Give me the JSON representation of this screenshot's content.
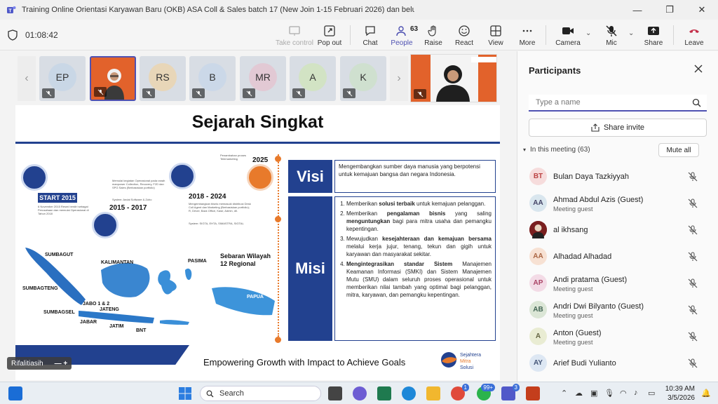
{
  "window": {
    "title": "Training Online Orientasi Karyawan Baru (OKB) ASA Coll & Sales batch 17 (New Join 1-15 Februari 2026) dan belu...",
    "minimize": "—",
    "restore": "❐",
    "close": "✕"
  },
  "toolbar": {
    "timer": "01:08:42",
    "take_control": "Take control",
    "pop_out": "Pop out",
    "chat": "Chat",
    "people": "People",
    "people_count": "63",
    "raise": "Raise",
    "react": "React",
    "view": "View",
    "more": "More",
    "camera": "Camera",
    "mic": "Mic",
    "share": "Share",
    "leave": "Leave"
  },
  "tiles": [
    {
      "initials": "EP",
      "color": "#c9d7e6"
    },
    {
      "initials": "",
      "video": true
    },
    {
      "initials": "RS",
      "color": "#e8d6b8"
    },
    {
      "initials": "B",
      "color": "#cbd8e8"
    },
    {
      "initials": "MR",
      "color": "#e2c9d4"
    },
    {
      "initials": "A",
      "color": "#d2e3c4"
    },
    {
      "initials": "K",
      "color": "#cfe0cf"
    }
  ],
  "slide": {
    "title": "Sejarah Singkat",
    "timeline": {
      "start": "START 2015",
      "y2015": "2015 - 2017",
      "y2018": "2018 - 2024",
      "y2025": "2025"
    },
    "tiny_text": {
      "t1": "6 November 2015 Resmi berdiri sebagai Perusahaan dan memulai Operasional di Tahun 2018",
      "t2": "Memulai kegiatan Operasional pada ranah manpower Collection, Recovery, F2D dan SPG Sales (Berbasiskan portfolio)",
      "t3": "System: Andal Software & Zoho",
      "t4": "Mengembangkan bisnis memasuki distribusi Desk Coll Agent dan Marketing (Berbasiskan portfolio); R, Driver, Back Office, Kasir, Admin, dll.",
      "t5": "System: SIGTA, EHTA, SIMASTRA, SIGTAL",
      "t6": "Penambahan proses Telemarketing"
    },
    "sebaran_line1": "Sebaran Wilayah",
    "sebaran_line2": "12 Regional",
    "regions": {
      "sumbagut": "SUMBAGUT",
      "kalimantan": "KALIMANTAN",
      "sumbagteng": "SUMBAGTENG",
      "jabo": "JABO 1 & 2",
      "jateng": "JATENG",
      "sumbagsel": "SUMBAGSEL",
      "jabar": "JABAR",
      "jatim": "JATIM",
      "bnt": "BNT",
      "pasima": "PASIMA",
      "papua": "PAPUA"
    },
    "visi_label": "Visi",
    "misi_label": "Misi",
    "visi_text": "Mengembangkan sumber daya manusia yang berpotensi untuk kemajuan bangsa dan negara Indonesia.",
    "misi": [
      {
        "pre": "Memberikan ",
        "bold": "solusi terbaik",
        "post": " untuk kemajuan pelanggan."
      },
      {
        "pre": "Memberikan ",
        "bold": "pengalaman bisnis",
        "post": " yang saling ",
        "bold2": "menguntungkan",
        "post2": " bagi para mitra usaha dan pemangku kepentingan."
      },
      {
        "pre": "Mewujudkan ",
        "bold": "kesejahteraan dan kemajuan bersama",
        "post": " melalui kerja jujur, tenang, tekun dan gigih untuk karyawan dan masyarakat sekitar."
      },
      {
        "pre": "",
        "bold": "Mengintegrasikan standar Sistem",
        "post": " Manajemen Keamanan Informasi (SMKI) dan Sistem Manajemen Mutu (SMU) dalam seluruh proses operasional untuk memberikan nilai tambah yang optimal bagi pelanggan, mitra, karyawan, dan pemangku kepentingan."
      }
    ],
    "footer": "Empowering Growth with Impact to Achieve Goals",
    "logo_line1": "Sejahtera",
    "logo_line2": "Mitra",
    "logo_line3": "Solusi"
  },
  "name_tag": {
    "name": "Rifalitiasih",
    "pin": "—   +"
  },
  "panel": {
    "title": "Participants",
    "search_placeholder": "Type a name",
    "share_invite": "Share invite",
    "in_meeting": "In this meeting (63)",
    "mute_all": "Mute all",
    "participants": [
      {
        "initials": "BT",
        "name": "Bulan Daya Tazkiyyah",
        "sub": "",
        "bg": "#f6dcdc",
        "fg": "#b44"
      },
      {
        "initials": "AA",
        "name": "Ahmad Abdul Azis (Guest)",
        "sub": "Meeting guest",
        "bg": "#d9e6ee",
        "fg": "#446"
      },
      {
        "initials": "",
        "name": "al ikhsang",
        "sub": "",
        "bg": "#7a1f1f",
        "fg": "#fff",
        "photo": true
      },
      {
        "initials": "AA",
        "name": "Alhadad Alhadad",
        "sub": "",
        "bg": "#f7e1d3",
        "fg": "#a64"
      },
      {
        "initials": "AP",
        "name": "Andi pratama (Guest)",
        "sub": "Meeting guest",
        "bg": "#f3dbe6",
        "fg": "#a46"
      },
      {
        "initials": "AB",
        "name": "Andri Dwi Bilyanto (Guest)",
        "sub": "Meeting guest",
        "bg": "#dbe6d6",
        "fg": "#465"
      },
      {
        "initials": "A",
        "name": "Anton (Guest)",
        "sub": "Meeting guest",
        "bg": "#e9ecd3",
        "fg": "#664"
      },
      {
        "initials": "AY",
        "name": "Arief Budi Yulianto",
        "sub": "",
        "bg": "#dde7f3",
        "fg": "#457"
      }
    ]
  },
  "taskbar": {
    "search": "Search",
    "teams_badge": "3",
    "whatsapp_badge": "99+",
    "chrome_badge": "1",
    "time": "10:39 AM",
    "date": "3/5/2026"
  }
}
